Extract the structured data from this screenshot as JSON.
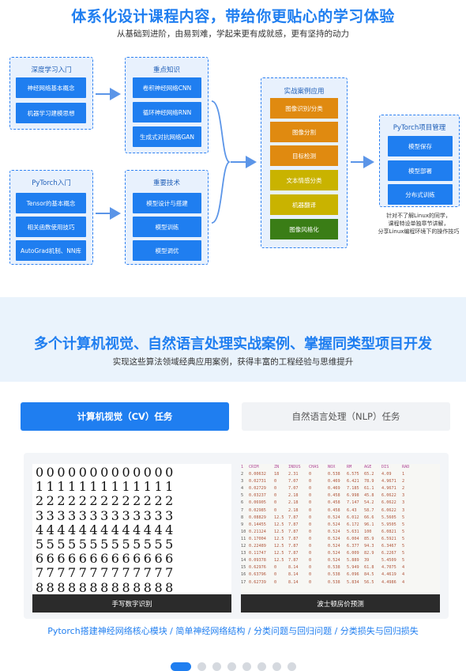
{
  "header": {
    "title": "体系化设计课程内容，带给你更贴心的学习体验",
    "subtitle": "从基础到进阶，由易到难，学起来更有成就感，更有坚持的动力"
  },
  "diagram": {
    "g1": {
      "title": "深度学习入门",
      "items": [
        "神经网络基本概念",
        "机器学习建模思想"
      ]
    },
    "g2": {
      "title": "重点知识",
      "items": [
        "卷积神经网络CNN",
        "循环神经网络RNN",
        "生成式对抗网络GAN"
      ]
    },
    "g3": {
      "title": "PyTorch入门",
      "items": [
        "Tensor的基本概念",
        "相关函数使用技巧",
        "AutoGrad机制、NN库"
      ]
    },
    "g4": {
      "title": "重要技术",
      "items": [
        "模型设计与搭建",
        "模型训练",
        "模型调优"
      ]
    },
    "g5": {
      "title": "实战案例应用",
      "items": [
        "图像识别/分类",
        "图像分割",
        "目标检测",
        "文本情感分类",
        "机器翻译",
        "图像风格化"
      ],
      "colors": [
        "#e08a10",
        "#e08a10",
        "#e08a10",
        "#c9b300",
        "#c9b300",
        "#3a7d16"
      ]
    },
    "g6": {
      "title": "PyTorch项目管理",
      "items": [
        "模型保存",
        "模型部署",
        "分布式训练"
      ]
    },
    "note": [
      "针对不了解Linux的同学，",
      "课程特设单独章节讲解，",
      "分享Linux编程环境下的操作技巧"
    ]
  },
  "section2": {
    "title": "多个计算机视觉、自然语言处理实战案例、掌握同类型项目开发",
    "subtitle": "实现这些算法领域经典应用案例，获得丰富的工程经验与思维提升"
  },
  "tabs": [
    {
      "label": "计算机视觉（CV）任务",
      "active": true
    },
    {
      "label": "自然语言处理（NLP）任务",
      "active": false
    }
  ],
  "cards": [
    {
      "caption": "手写数字识别",
      "digit_rows": [
        "0000000000000",
        "1111111111111",
        "2222222222222",
        "3333333333333",
        "4444444444444",
        "5555555555555",
        "6666666666666",
        "7777777777777",
        "8888888888888"
      ]
    },
    {
      "caption": "波士顿房价预测",
      "table_header": [
        "1",
        "CRIM",
        "ZN",
        "INDUS",
        "CHAS",
        "NOX",
        "RM",
        "AGE",
        "DIS",
        "RAD"
      ],
      "table_rows": [
        [
          "2",
          "0.00632",
          "18",
          "2.31",
          "0",
          "0.538",
          "6.575",
          "65.2",
          "4.09",
          "1"
        ],
        [
          "3",
          "0.02731",
          "0",
          "7.07",
          "0",
          "0.469",
          "6.421",
          "78.9",
          "4.9671",
          "2"
        ],
        [
          "4",
          "0.02729",
          "0",
          "7.07",
          "0",
          "0.469",
          "7.185",
          "61.1",
          "4.9671",
          "2"
        ],
        [
          "5",
          "0.03237",
          "0",
          "2.18",
          "0",
          "0.458",
          "6.998",
          "45.8",
          "6.0622",
          "3"
        ],
        [
          "6",
          "0.06905",
          "0",
          "2.18",
          "0",
          "0.458",
          "7.147",
          "54.2",
          "6.0622",
          "3"
        ],
        [
          "7",
          "0.02985",
          "0",
          "2.18",
          "0",
          "0.458",
          "6.43",
          "58.7",
          "6.0622",
          "3"
        ],
        [
          "8",
          "0.08829",
          "12.5",
          "7.87",
          "0",
          "0.524",
          "6.012",
          "66.6",
          "5.5605",
          "5"
        ],
        [
          "9",
          "0.14455",
          "12.5",
          "7.87",
          "0",
          "0.524",
          "6.172",
          "96.1",
          "5.9505",
          "5"
        ],
        [
          "10",
          "0.21124",
          "12.5",
          "7.87",
          "0",
          "0.524",
          "5.631",
          "100",
          "6.0821",
          "5"
        ],
        [
          "11",
          "0.17004",
          "12.5",
          "7.87",
          "0",
          "0.524",
          "6.004",
          "85.9",
          "6.5921",
          "5"
        ],
        [
          "12",
          "0.22489",
          "12.5",
          "7.87",
          "0",
          "0.524",
          "6.377",
          "94.3",
          "6.3467",
          "5"
        ],
        [
          "13",
          "0.11747",
          "12.5",
          "7.87",
          "0",
          "0.524",
          "6.009",
          "82.9",
          "6.2267",
          "5"
        ],
        [
          "14",
          "0.09378",
          "12.5",
          "7.87",
          "0",
          "0.524",
          "5.889",
          "39",
          "5.4509",
          "5"
        ],
        [
          "15",
          "0.62976",
          "0",
          "8.14",
          "0",
          "0.538",
          "5.949",
          "61.8",
          "4.7075",
          "4"
        ],
        [
          "16",
          "0.63796",
          "0",
          "8.14",
          "0",
          "0.538",
          "6.096",
          "84.5",
          "4.4619",
          "4"
        ],
        [
          "17",
          "0.62739",
          "0",
          "8.14",
          "0",
          "0.538",
          "5.834",
          "56.5",
          "4.4986",
          "4"
        ]
      ]
    }
  ],
  "topics": "Pytorch搭建神经网络核心模块 / 简单神经网络结构 / 分类问题与回归问题 / 分类损失与回归损失",
  "pagination": {
    "count": 8,
    "active": 0
  }
}
